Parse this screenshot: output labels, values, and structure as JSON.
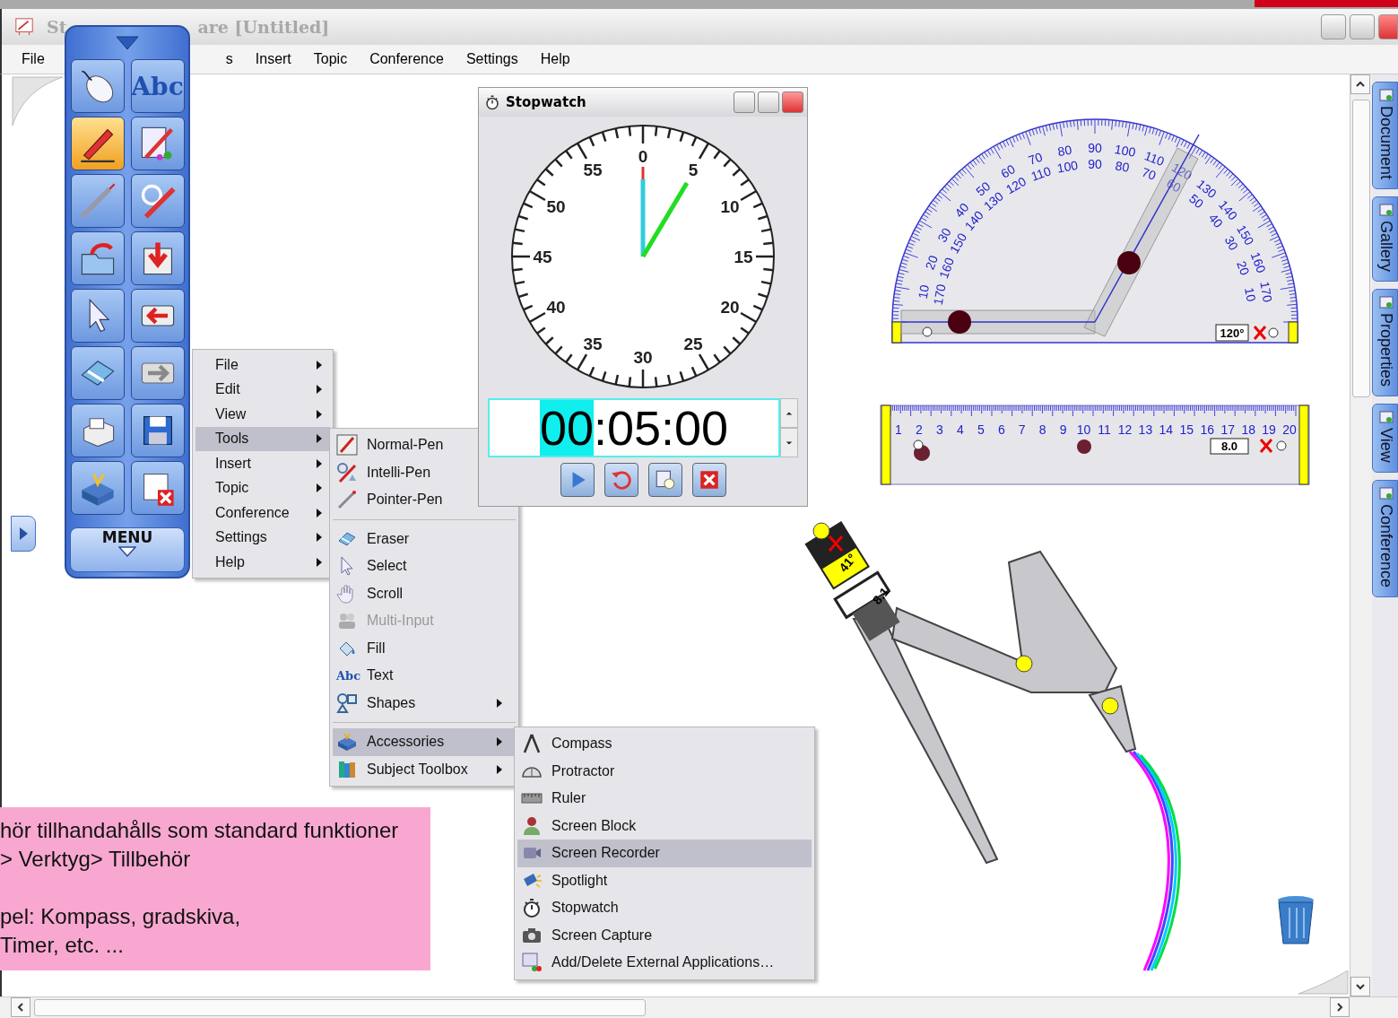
{
  "window": {
    "title_parts": [
      "St",
      "are [Untitled]"
    ]
  },
  "menu_bar": {
    "left": [
      "File"
    ],
    "right": [
      "s",
      "Insert",
      "Topic",
      "Conference",
      "Settings",
      "Help"
    ]
  },
  "toolbar": {
    "buttons": [
      {
        "kind": "mouse",
        "selected": false
      },
      {
        "kind": "abc",
        "label": "Abc",
        "selected": false
      },
      {
        "kind": "pen",
        "selected": true
      },
      {
        "kind": "intelli-pen",
        "selected": false
      },
      {
        "kind": "pointer-pen",
        "selected": false
      },
      {
        "kind": "shape-pen",
        "selected": false
      },
      {
        "kind": "open",
        "selected": false
      },
      {
        "kind": "import",
        "selected": false
      },
      {
        "kind": "pointer",
        "selected": false
      },
      {
        "kind": "back",
        "selected": false
      },
      {
        "kind": "eraser",
        "selected": false
      },
      {
        "kind": "forward",
        "selected": false
      },
      {
        "kind": "print",
        "selected": false
      },
      {
        "kind": "save",
        "selected": false
      },
      {
        "kind": "tools",
        "selected": false
      },
      {
        "kind": "delete-page",
        "selected": false
      }
    ],
    "menu_label": "MENU"
  },
  "main_menu": [
    {
      "label": "File",
      "selected": false
    },
    {
      "label": "Edit",
      "selected": false
    },
    {
      "label": "View",
      "selected": false
    },
    {
      "label": "Tools",
      "selected": true
    },
    {
      "label": "Insert",
      "selected": false
    },
    {
      "label": "Topic",
      "selected": false
    },
    {
      "label": "Conference",
      "selected": false
    },
    {
      "label": "Settings",
      "selected": false
    },
    {
      "label": "Help",
      "selected": false
    }
  ],
  "tools_menu": [
    [
      {
        "kind": "normal-pen",
        "label": "Normal-Pen",
        "selected": false,
        "disabled": false
      },
      {
        "kind": "intelli-pen",
        "label": "Intelli-Pen",
        "selected": false,
        "disabled": false
      },
      {
        "kind": "pointer-pen",
        "label": "Pointer-Pen",
        "selected": false,
        "disabled": false
      }
    ],
    [
      {
        "kind": "eraser",
        "label": "Eraser",
        "selected": false,
        "disabled": false
      },
      {
        "kind": "select",
        "label": "Select",
        "selected": false,
        "disabled": false
      },
      {
        "kind": "scroll",
        "label": "Scroll",
        "selected": false,
        "disabled": false
      },
      {
        "kind": "multi-input",
        "label": "Multi-Input",
        "selected": false,
        "disabled": true
      },
      {
        "kind": "fill",
        "label": "Fill",
        "selected": false,
        "disabled": false
      },
      {
        "kind": "text",
        "label": "Text",
        "icon_text": "Abc",
        "selected": false,
        "disabled": false
      },
      {
        "kind": "shapes",
        "label": "Shapes",
        "selected": false,
        "disabled": false,
        "submenu": true
      }
    ],
    [
      {
        "kind": "accessories",
        "label": "Accessories",
        "selected": true,
        "disabled": false,
        "submenu": true
      },
      {
        "kind": "toolbox",
        "label": "Subject Toolbox",
        "selected": false,
        "disabled": false,
        "submenu": true
      }
    ]
  ],
  "accessories_menu": [
    {
      "kind": "compass",
      "label": "Compass",
      "selected": false
    },
    {
      "kind": "protractor",
      "label": "Protractor",
      "selected": false
    },
    {
      "kind": "ruler",
      "label": "Ruler",
      "selected": false
    },
    {
      "kind": "screen-block",
      "label": "Screen Block",
      "selected": false
    },
    {
      "kind": "screen-recorder",
      "label": "Screen Recorder",
      "selected": true
    },
    {
      "kind": "spotlight",
      "label": "Spotlight",
      "selected": false
    },
    {
      "kind": "stopwatch",
      "label": "Stopwatch",
      "selected": false
    },
    {
      "kind": "screen-capture",
      "label": "Screen Capture",
      "selected": false
    },
    {
      "kind": "add-apps",
      "label": "Add/Delete External Applications…",
      "selected": false
    }
  ],
  "stopwatch": {
    "title": "Stopwatch",
    "dial_labels": [
      "0",
      "5",
      "10",
      "15",
      "20",
      "25",
      "30",
      "35",
      "40",
      "45",
      "50",
      "55"
    ],
    "time_parts": [
      {
        "text": "00",
        "selected": true
      },
      {
        "text": ":05:00",
        "selected": false
      }
    ]
  },
  "protractor": {
    "outer_scale": [
      "10",
      "20",
      "30",
      "40",
      "50",
      "60",
      "70",
      "80",
      "90",
      "100",
      "110",
      "120",
      "130",
      "140",
      "150",
      "160",
      "170"
    ],
    "inner_scale": [
      "170",
      "160",
      "150",
      "140",
      "130",
      "120",
      "110",
      "100",
      "90",
      "80",
      "70",
      "60",
      "50",
      "40",
      "30",
      "20",
      "10"
    ],
    "reading": "120°"
  },
  "ruler": {
    "scale": [
      "1",
      "2",
      "3",
      "4",
      "5",
      "6",
      "7",
      "8",
      "9",
      "10",
      "11",
      "12",
      "13",
      "14",
      "15",
      "16",
      "17",
      "18",
      "19",
      "20"
    ],
    "reading": "8.0"
  },
  "compass": {
    "angle": "41°",
    "radius": "8.1"
  },
  "note": {
    "paragraphs": [
      [
        "hör tillhandahålls som standard funktioner",
        "> Verktyg> Tillbehör"
      ],
      [
        "pel: Kompass, gradskiva,",
        " Timer, etc. ..."
      ]
    ]
  },
  "sidebar_tabs": [
    {
      "label": "Document",
      "selected": false
    },
    {
      "label": "Gallery",
      "selected": false
    },
    {
      "label": "Properties",
      "selected": false
    },
    {
      "label": "View",
      "selected": false
    },
    {
      "label": "Conference",
      "selected": false
    }
  ]
}
